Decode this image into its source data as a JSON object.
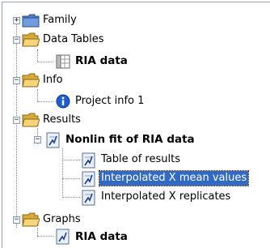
{
  "tree": {
    "family": {
      "label": "Family",
      "icon": "folder-icon",
      "expander": "+"
    },
    "data_tables": {
      "label": "Data Tables",
      "icon": "folder-open-icon",
      "expander": "−",
      "children": [
        {
          "label": "RIA data",
          "icon": "data-table-icon"
        }
      ]
    },
    "info": {
      "label": "Info",
      "icon": "folder-open-icon",
      "expander": "−",
      "children": [
        {
          "label": "Project info 1",
          "icon": "info-icon"
        }
      ]
    },
    "results": {
      "label": "Results",
      "icon": "folder-open-icon",
      "expander": "−",
      "children": [
        {
          "label": "Nonlin fit of RIA data",
          "icon": "results-sheet-icon",
          "expander": "−",
          "children": [
            {
              "label": "Table of results",
              "icon": "results-sheet-icon"
            },
            {
              "label": "Interpolated X mean values",
              "icon": "results-sheet-icon",
              "selected": true
            },
            {
              "label": "Interpolated  X replicates",
              "icon": "results-sheet-icon"
            }
          ]
        }
      ]
    },
    "graphs": {
      "label": "Graphs",
      "icon": "folder-open-icon",
      "expander": "−",
      "children": [
        {
          "label": "RIA data",
          "icon": "graph-icon"
        }
      ]
    }
  },
  "colors": {
    "selection": "#316ac5",
    "folder": "#e8c15a",
    "info": "#1f5fd6"
  }
}
